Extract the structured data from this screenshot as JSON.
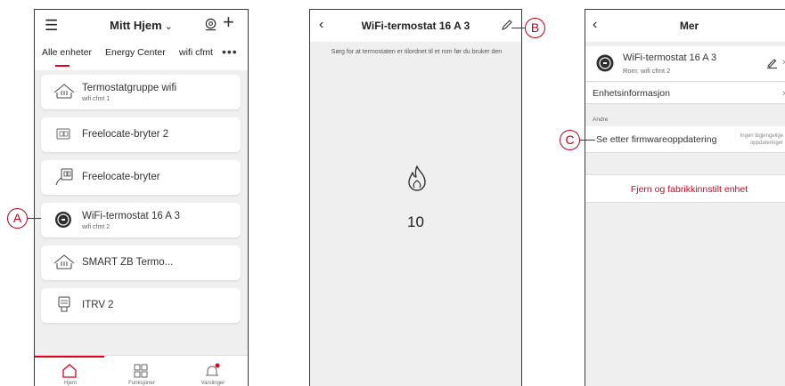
{
  "colors": {
    "accent": "#e2001a",
    "background": "#efefef",
    "card": "#ffffff",
    "callout": "#c0001a"
  },
  "screen1": {
    "icons": {
      "menu": "hamburger-icon",
      "dropdown": "chevron-down-icon",
      "scan": "scan-icon",
      "add": "plus-icon",
      "more": "ellipsis-icon"
    },
    "title": "Mitt Hjem",
    "tabs": [
      "Alle enheter",
      "Energy Center",
      "wifi cfmt"
    ],
    "devices": [
      {
        "name": "Termostatgruppe wifi",
        "room": "wifi cfmt 1",
        "icon": "heater-icon"
      },
      {
        "name": "Freelocate-bryter 2",
        "room": "",
        "icon": "switch-icon"
      },
      {
        "name": "Freelocate-bryter",
        "room": "",
        "icon": "switch-icon"
      },
      {
        "name": "WiFi-termostat 16 A 3",
        "room": "wifi cfmt 2",
        "icon": "thermostat-icon"
      },
      {
        "name": "SMART ZB Termo...",
        "room": "",
        "icon": "heater-icon"
      },
      {
        "name": "ITRV 2",
        "room": "",
        "icon": "valve-icon"
      }
    ],
    "bottom_nav": [
      {
        "label": "Hjem",
        "icon": "home-icon"
      },
      {
        "label": "Funksjoner",
        "icon": "grid-icon"
      },
      {
        "label": "Varslinger",
        "icon": "bell-icon"
      }
    ]
  },
  "screen2": {
    "icons": {
      "back": "back-icon",
      "edit": "pencil-icon",
      "flame": "flame-icon"
    },
    "title": "WiFi-termostat 16 A 3",
    "message": "Sørg for at termostaten er tilordnet til et rom før du bruker den",
    "value": "10"
  },
  "screen3": {
    "icons": {
      "back": "back-icon",
      "device": "thermostat-icon",
      "edit": "pencil-icon",
      "arrow": "chevron-right-icon"
    },
    "title": "Mer",
    "device_name": "WiFi-termostat 16 A 3",
    "device_room": "Rom: wifi cfmt 2",
    "info_label": "Enhetsinformasjon",
    "section_label": "Andre",
    "firmware_label": "Se etter firmwareoppdatering",
    "firmware_status": "Ingen tilgjengelige oppdateringer",
    "remove_label": "Fjern og fabrikkinnstilt enhet"
  },
  "callouts": {
    "a": "A",
    "b": "B",
    "c": "C"
  }
}
